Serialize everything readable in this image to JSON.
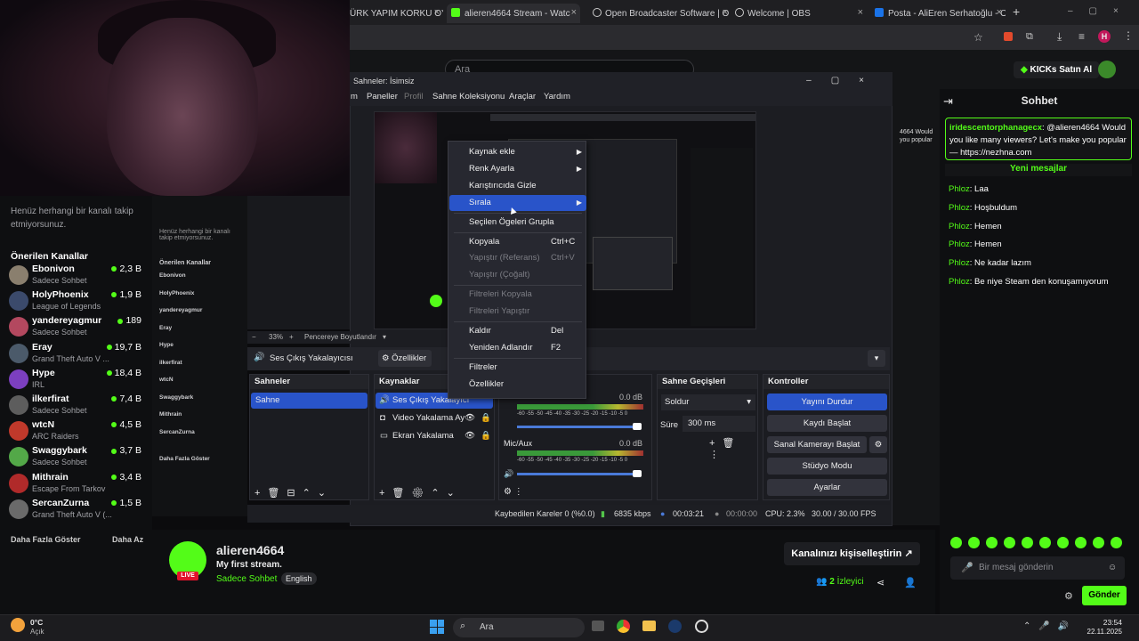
{
  "browser": {
    "tabs": [
      {
        "label": "ÜRK YAPIM KORKU OY",
        "active": false
      },
      {
        "label": "alieren4664 Stream - Watc",
        "active": true
      },
      {
        "label": "Open Broadcaster Software | O",
        "active": false
      },
      {
        "label": "Welcome | OBS",
        "active": false
      },
      {
        "label": "Posta - AliEren Serhatoğlu - Ou",
        "active": false
      }
    ],
    "new_tab": "+",
    "avatar_letter": "H"
  },
  "kick": {
    "search_placeholder": "Ara",
    "kicks_button": "KICKs Satın Al"
  },
  "sidebar": {
    "no_follow_text": "Henüz herhangi bir kanalı takip etmiyorsunuz.",
    "recommended_title": "Önerilen Kanallar",
    "channels": [
      {
        "name": "Ebonivon",
        "category": "Sadece Sohbet",
        "viewers": "2,3 B",
        "color": "#8a7f6e"
      },
      {
        "name": "HolyPhoenix",
        "category": "League of Legends",
        "viewers": "1,9 B",
        "color": "#3b4a6b"
      },
      {
        "name": "yandereyagmur",
        "category": "Sadece Sohbet",
        "viewers": "189",
        "color": "#b3485f"
      },
      {
        "name": "Eray",
        "category": "Grand Theft Auto V ...",
        "viewers": "19,7 B",
        "color": "#4b5a6a"
      },
      {
        "name": "Hype",
        "category": "IRL",
        "viewers": "18,4 B",
        "color": "#7c3fc0"
      },
      {
        "name": "ilkerfirat",
        "category": "Sadece Sohbet",
        "viewers": "7,4 B",
        "color": "#5d5d5d"
      },
      {
        "name": "wtcN",
        "category": "ARC Raiders",
        "viewers": "4,5 B",
        "color": "#c0392b"
      },
      {
        "name": "Swaggybark",
        "category": "Sadece Sohbet",
        "viewers": "3,7 B",
        "color": "#53a848"
      },
      {
        "name": "Mithrain",
        "category": "Escape From Tarkov",
        "viewers": "3,4 B",
        "color": "#b02a2a"
      },
      {
        "name": "SercanZurna",
        "category": "Grand Theft Auto V (...",
        "viewers": "1,5 B",
        "color": "#6a6a6a"
      }
    ],
    "show_more": "Daha Fazla Göster",
    "show_less": "Daha Az"
  },
  "obs": {
    "title": "Sahneler: İsimsiz",
    "menu": [
      "m",
      "Paneller",
      "Profil",
      "Sahne Koleksiyonu",
      "Araçlar",
      "Yardım"
    ],
    "zoom": "33%",
    "fit": "Pencereye Boyutlandır",
    "source_name": "Ses Çıkış Yakalayıcısı",
    "properties_btn": "Özellikler",
    "docks": {
      "scenes": {
        "title": "Sahneler",
        "items": [
          "Sahne"
        ]
      },
      "sources": {
        "title": "Kaynaklar",
        "items": [
          "Ses Çıkış Yakalayıcı",
          "Video Yakalama Ay",
          "Ekran Yakalama"
        ]
      },
      "mixer": {
        "db1": "0.0 dB",
        "mic_label": "Mic/Aux",
        "db2": "0.0 dB",
        "scale": "-60 -55 -50 -45 -40 -35 -30 -25 -20 -15 -10 -5 0"
      },
      "transitions": {
        "title": "Sahne Geçişleri",
        "transition": "Soldur",
        "duration_label": "Süre",
        "duration": "300 ms"
      },
      "controls": {
        "title": "Kontroller",
        "stop_stream": "Yayını Durdur",
        "start_record": "Kaydı Başlat",
        "virtual_cam": "Sanal Kamerayı Başlat",
        "studio_mode": "Stüdyo Modu",
        "settings": "Ayarlar"
      }
    },
    "status": {
      "dropped": "Kaybedilen Kareler 0 (%0.0)",
      "bitrate": "6835 kbps",
      "live_time": "00:03:21",
      "rec_time": "00:00:00",
      "cpu": "CPU: 2.3%",
      "fps": "30.00 / 30.00 FPS"
    },
    "context_menu": [
      {
        "label": "Kaynak ekle",
        "shortcut": "",
        "submenu": true,
        "disabled": false,
        "selected": false
      },
      {
        "label": "Renk Ayarla",
        "shortcut": "",
        "submenu": true,
        "disabled": false,
        "selected": false
      },
      {
        "label": "Karıştırıcıda Gizle",
        "shortcut": "",
        "submenu": false,
        "disabled": false,
        "selected": false
      },
      {
        "label": "Sırala",
        "shortcut": "",
        "submenu": true,
        "disabled": false,
        "selected": true
      },
      {
        "label": "Seçilen Ögeleri Grupla",
        "shortcut": "",
        "submenu": false,
        "disabled": false,
        "selected": false
      },
      {
        "label": "Kopyala",
        "shortcut": "Ctrl+C",
        "submenu": false,
        "disabled": false,
        "selected": false
      },
      {
        "label": "Yapıştır (Referans)",
        "shortcut": "Ctrl+V",
        "submenu": false,
        "disabled": true,
        "selected": false
      },
      {
        "label": "Yapıştır (Çoğalt)",
        "shortcut": "",
        "submenu": false,
        "disabled": true,
        "selected": false
      },
      {
        "label": "Filtreleri Kopyala",
        "shortcut": "",
        "submenu": false,
        "disabled": true,
        "selected": false
      },
      {
        "label": "Filtreleri Yapıştır",
        "shortcut": "",
        "submenu": false,
        "disabled": true,
        "selected": false
      },
      {
        "label": "Kaldır",
        "shortcut": "Del",
        "submenu": false,
        "disabled": false,
        "selected": false
      },
      {
        "label": "Yeniden Adlandır",
        "shortcut": "F2",
        "submenu": false,
        "disabled": false,
        "selected": false
      },
      {
        "label": "Filtreler",
        "shortcut": "",
        "submenu": false,
        "disabled": false,
        "selected": false
      },
      {
        "label": "Özellikler",
        "shortcut": "",
        "submenu": false,
        "disabled": false,
        "selected": false
      }
    ]
  },
  "chat": {
    "title": "Sohbet",
    "pinned": {
      "user": "iridescentorphanagecx",
      "text": ": @alieren4664 Would you like many viewers? Let's make you popular — https://nezhna.com"
    },
    "new_messages": "Yeni mesajlar",
    "messages": [
      {
        "user": "Phloz",
        "text": ": Laa"
      },
      {
        "user": "Phloz",
        "text": ": Hoşbuldum"
      },
      {
        "user": "Phloz",
        "text": ": Hemen"
      },
      {
        "user": "Phloz",
        "text": ": Hemen"
      },
      {
        "user": "Phloz",
        "text": ": Ne kadar lazım"
      },
      {
        "user": "Phloz",
        "text": ": Be niye Steam den konuşamıyorum"
      }
    ],
    "input_placeholder": "Bir mesaj gönderin",
    "send": "Gönder"
  },
  "stream": {
    "channel": "alieren4664",
    "title": "My first stream.",
    "category": "Sadece Sohbet",
    "language": "English",
    "live": "LIVE",
    "customize": "Kanalınızı kişiselleştirin",
    "viewers": "2",
    "viewers_label": "İzleyici"
  },
  "taskbar": {
    "weather_temp": "0°C",
    "weather_desc": "Açık",
    "search": "Ara",
    "time": "23:54",
    "date": "22.11.2025"
  }
}
